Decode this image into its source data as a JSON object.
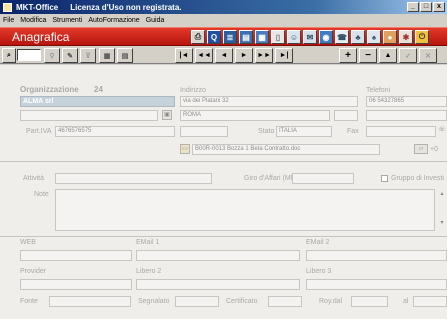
{
  "window": {
    "app_name": "MKT-Office",
    "title_note": "Licenza d'Uso non registrata.",
    "min": "_",
    "max": "□",
    "close": "x"
  },
  "menu": [
    "File",
    "Modifica",
    "Strumenti",
    "AutoFormazione",
    "Guida"
  ],
  "header": {
    "title": "Anagrafica"
  },
  "nav": {
    "search_value": "",
    "first": "|◄",
    "prev_page": "◄◄",
    "prev": "◄",
    "next": "►",
    "next_page": "►►",
    "last": "►|",
    "add": "+",
    "remove": "−",
    "up": "▲",
    "confirm": "✓",
    "cancel": "✕"
  },
  "form": {
    "organizzazione_label": "Organizzazione",
    "record_number": "24",
    "organizzazione_value": "ALMA srl",
    "indirizzo_label": "Indirizzo",
    "indirizzo_value": "via dei Platani 32",
    "telefoni_label": "Telefoni",
    "telefono_value": "06 54327865",
    "citta_value": "ROMA",
    "piva_label": "Part.IVA",
    "piva_value": "4676576575",
    "stato_label": "Stato",
    "stato_value": "ITALIA",
    "fax_label": "Fax",
    "documento_value": "B00R-0013 Bozza 1 Beta Contratto.doc",
    "doc_counter": "+0",
    "attivita_label": "Attività",
    "giro_affari_label": "Giro d'Affari (Mld.)",
    "gruppo_label": "Gruppo di Investi",
    "note_label": "Note",
    "web_label": "WEB",
    "email1_label": "EMail 1",
    "email2_label": "EMail 2",
    "provider_label": "Provider",
    "libero2_label": "Libero 2",
    "libero3_label": "Libero 3",
    "fonte_label": "Fonte",
    "segnalato_label": "Segnalato",
    "certificato_label": "Certificato",
    "roy_dal_label": "Roy.dal",
    "al_label": "al"
  },
  "colors": {
    "header_red": "#c91f16",
    "title_blue": "#0a246a",
    "field_blue": "#c5d2da"
  }
}
